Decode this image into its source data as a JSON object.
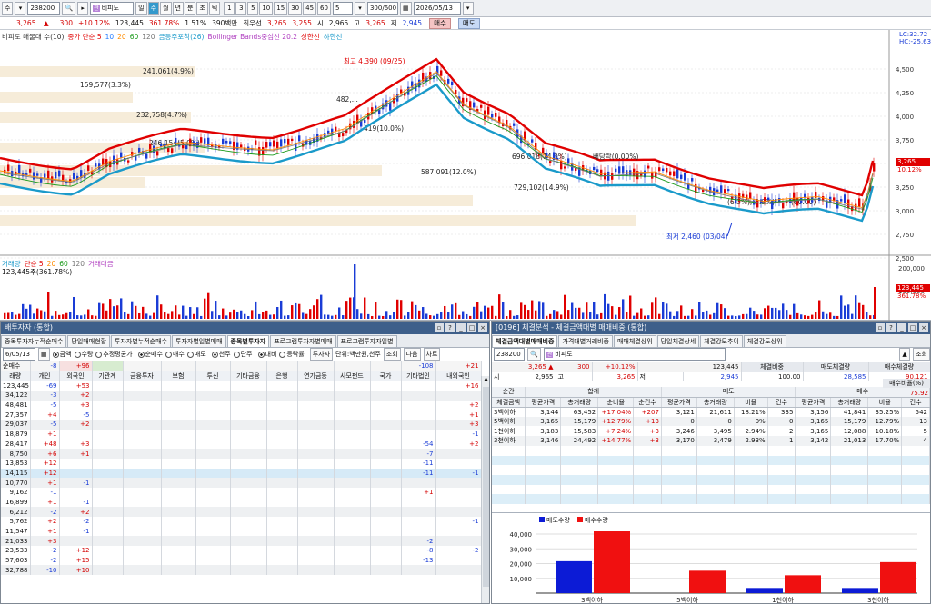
{
  "toolbar": {
    "acct": "주",
    "code": "238200",
    "name": "비피도",
    "period_buttons": [
      "일",
      "주",
      "월",
      "년",
      "분",
      "초",
      "틱"
    ],
    "interval_buttons": [
      "1",
      "3",
      "5",
      "10",
      "15",
      "30",
      "45",
      "60"
    ],
    "interval_sel": "5",
    "count": "300/600",
    "date": "2026/05/13"
  },
  "quote": {
    "price": "3,265",
    "arrow": "▲",
    "change": "300",
    "pct": "+10.12%",
    "volume": "123,445",
    "vol_pct": "361.78%",
    "turnover": "1.51%",
    "amount": "390백만",
    "best_label": "최우선",
    "ask": "3,265",
    "bid": "3,255",
    "open_label": "시",
    "open": "2,965",
    "high_label": "고",
    "high": "3,265",
    "low_label": "저",
    "low": "2,945",
    "buy": "매수",
    "sell": "매도"
  },
  "chart": {
    "legend_main": [
      "비피도 매물대 수(10)",
      "종가 단순 5",
      "10",
      "20",
      "60",
      "120",
      "금등주포착(26)",
      "Bollinger Bands중심선 20.2",
      "상한선",
      "하한선"
    ],
    "legend_colors": [
      "#333",
      "#e00000",
      "#2a7fff",
      "#ff8c00",
      "#1a9a1a",
      "#777",
      "#1a9aca",
      "#b040c0",
      "#e00000",
      "#1a9aca"
    ],
    "price_axis": [
      "4,500",
      "4,250",
      "4,000",
      "3,750",
      "3,500",
      "3,250",
      "3,000",
      "2,750",
      "2,500"
    ],
    "right_tags": [
      "LC:32.72",
      "HC:-25.63"
    ],
    "price_tag": "3,265",
    "price_tag_pct": "10.12%",
    "volume_profile": [
      "241,061(4.9%)",
      "159,577(3.3%)",
      "232,758(4.7%)",
      "246,154(5.0%)",
      "482,...",
      "419(10.0%)",
      "696,018(14.3%)",
      "587,091(12.0%)",
      "729,102(14.9%)",
      "(6.3%),(2.9%)",
      "(60.00)"
    ],
    "high_mark": "최고 4,390 (09/25)",
    "low_mark": "최저 2,460 (03/04)",
    "dividend_mark": "배당락(0.00%)",
    "vol_legend": [
      "거래량",
      "단순 5",
      "20",
      "60",
      "120",
      "거래대금"
    ],
    "vol_legend_colors": [
      "#1a9aca",
      "#e00000",
      "#ff8c00",
      "#1a9a1a",
      "#777",
      "#b040c0"
    ],
    "vol_text": "123,445주(361.78%)",
    "vol_axis": [
      "200,000",
      "100,000"
    ],
    "vol_tag": "123,445",
    "vol_tag_pct": "361.78%"
  },
  "left": {
    "title": "배투자자 (통합)",
    "tabs": [
      "종목투자자누적순매수",
      "당일매매현황",
      "투자자별누적순매수",
      "투자자별일별매매",
      "종목별투자자",
      "프로그램투자자별매매",
      "프로그램투자자일별"
    ],
    "active_tab": 4,
    "date": "6/05/13",
    "opt1": [
      "금액",
      "수량",
      "추정평균가"
    ],
    "opt2": [
      "순매수",
      "매수",
      "매도"
    ],
    "opt3": [
      "천주",
      "단주"
    ],
    "opt4": [
      "대비",
      "등락률"
    ],
    "investor_btn": "투자자",
    "unit": "단위:백만원,천주",
    "btns": [
      "조회",
      "다음",
      "차트"
    ],
    "sum_row": {
      "label": "순매수",
      "v1": "-8",
      "v2": "+96",
      "v3": "-108",
      "v4": "+21"
    },
    "headers": [
      "래량",
      "개인",
      "외국인",
      "기관계",
      "금융투자",
      "보험",
      "투신",
      "기타금융",
      "은행",
      "연기금등",
      "사모펀드",
      "국가",
      "기타법인",
      "내외국인"
    ],
    "rows": [
      [
        "123,445",
        "-69",
        "+53",
        "",
        "",
        "",
        "",
        "",
        "",
        "",
        "",
        "",
        "",
        "+16"
      ],
      [
        "34,122",
        "-3",
        "+2",
        "",
        "",
        "",
        "",
        "",
        "",
        "",
        "",
        "",
        "",
        ""
      ],
      [
        "48,481",
        "-5",
        "+3",
        "",
        "",
        "",
        "",
        "",
        "",
        "",
        "",
        "",
        "",
        "+2"
      ],
      [
        "27,357",
        "+4",
        "-5",
        "",
        "",
        "",
        "",
        "",
        "",
        "",
        "",
        "",
        "",
        "+1"
      ],
      [
        "29,037",
        "-5",
        "+2",
        "",
        "",
        "",
        "",
        "",
        "",
        "",
        "",
        "",
        "",
        "+3"
      ],
      [
        "18,879",
        "+1",
        "",
        "",
        "",
        "",
        "",
        "",
        "",
        "",
        "",
        "",
        "",
        "-1"
      ],
      [
        "28,417",
        "+48",
        "+3",
        "",
        "",
        "",
        "",
        "",
        "",
        "",
        "",
        "",
        "-54",
        "+2"
      ],
      [
        "8,750",
        "+6",
        "+1",
        "",
        "",
        "",
        "",
        "",
        "",
        "",
        "",
        "",
        "-7",
        ""
      ],
      [
        "13,853",
        "+12",
        "",
        "",
        "",
        "",
        "",
        "",
        "",
        "",
        "",
        "",
        "-11",
        ""
      ],
      [
        "14,115",
        "+12",
        "",
        "",
        "",
        "",
        "",
        "",
        "",
        "",
        "",
        "",
        "-11",
        "-1"
      ],
      [
        "10,770",
        "+1",
        "-1",
        "",
        "",
        "",
        "",
        "",
        "",
        "",
        "",
        "",
        "",
        ""
      ],
      [
        "9,162",
        "-1",
        "",
        "",
        "",
        "",
        "",
        "",
        "",
        "",
        "",
        "",
        "+1",
        ""
      ],
      [
        "16,899",
        "+1",
        "-1",
        "",
        "",
        "",
        "",
        "",
        "",
        "",
        "",
        "",
        "",
        ""
      ],
      [
        "6,212",
        "-2",
        "+2",
        "",
        "",
        "",
        "",
        "",
        "",
        "",
        "",
        "",
        "",
        ""
      ],
      [
        "5,762",
        "+2",
        "-2",
        "",
        "",
        "",
        "",
        "",
        "",
        "",
        "",
        "",
        "",
        "-1"
      ],
      [
        "11,547",
        "+1",
        "-1",
        "",
        "",
        "",
        "",
        "",
        "",
        "",
        "",
        "",
        "",
        ""
      ],
      [
        "21,033",
        "+3",
        "",
        "",
        "",
        "",
        "",
        "",
        "",
        "",
        "",
        "",
        "-2",
        ""
      ],
      [
        "23,533",
        "-2",
        "+12",
        "",
        "",
        "",
        "",
        "",
        "",
        "",
        "",
        "",
        "-8",
        "-2"
      ],
      [
        "57,603",
        "-2",
        "+15",
        "",
        "",
        "",
        "",
        "",
        "",
        "",
        "",
        "",
        "-13",
        ""
      ],
      [
        "32,788",
        "-10",
        "+10",
        "",
        "",
        "",
        "",
        "",
        "",
        "",
        "",
        "",
        "",
        ""
      ]
    ]
  },
  "right": {
    "title": "[0196] 체결분석 - 체결금액대별 매매비중 (통합)",
    "tabs": [
      "체결금액대별매매비중",
      "가격대별거래비중",
      "매매체결상위",
      "당일체결상세",
      "체결강도추이",
      "체결강도상위"
    ],
    "active_tab": 0,
    "code": "238200",
    "name": "비피도",
    "query": "조회",
    "q1": {
      "price": "3,265",
      "arrow": "▲",
      "change": "300",
      "pct": "+10.12%",
      "vol": "123,445",
      "l1": "체결비중",
      "l2": "매도체결량",
      "l3": "매수체결량",
      "l4": "매수비율(%)"
    },
    "q2": {
      "open_l": "시",
      "open": "2,965",
      "high_l": "고",
      "high": "3,265",
      "low_l": "저",
      "low": "2,945",
      "v1": "100.00",
      "v2": "28,585",
      "v3": "90,121",
      "v4": "75.92"
    },
    "group_headers": [
      "순간",
      "합계",
      "매도",
      "매수"
    ],
    "headers": [
      "체결금액",
      "평균가격",
      "총거래량",
      "순비율",
      "순건수",
      "평균가격",
      "총거래량",
      "비율",
      "건수",
      "평균가격",
      "총거래량",
      "비율",
      "건수"
    ],
    "rows": [
      [
        "3백이하",
        "3,144",
        "63,452",
        "+17.04%",
        "+207",
        "3,121",
        "21,611",
        "18.21%",
        "335",
        "3,156",
        "41,841",
        "35.25%",
        "542"
      ],
      [
        "5백이하",
        "3,165",
        "15,179",
        "+12.79%",
        "+13",
        "0",
        "0",
        "0%",
        "0",
        "3,165",
        "15,179",
        "12.79%",
        "13"
      ],
      [
        "1천이하",
        "3,183",
        "15,583",
        "+7.24%",
        "+3",
        "3,246",
        "3,495",
        "2.94%",
        "2",
        "3,165",
        "12,088",
        "10.18%",
        "5"
      ],
      [
        "3천이하",
        "3,146",
        "24,492",
        "+14.77%",
        "+3",
        "3,170",
        "3,479",
        "2.93%",
        "1",
        "3,142",
        "21,013",
        "17.70%",
        "4"
      ]
    ],
    "bar_legend": [
      "매도수량",
      "매수수량"
    ],
    "bar_colors": [
      "#0c1bd6",
      "#f01010"
    ]
  },
  "chart_data": {
    "type": "bar",
    "categories": [
      "3백이하",
      "5백이하",
      "1천이하",
      "3천이하"
    ],
    "series": [
      {
        "name": "매도수량",
        "values": [
          21611,
          0,
          3495,
          3479
        ]
      },
      {
        "name": "매수수량",
        "values": [
          41841,
          15179,
          12088,
          21013
        ]
      }
    ],
    "yticks": [
      "40,000",
      "30,000",
      "20,000",
      "10,000"
    ],
    "ylim": [
      0,
      48000
    ]
  }
}
